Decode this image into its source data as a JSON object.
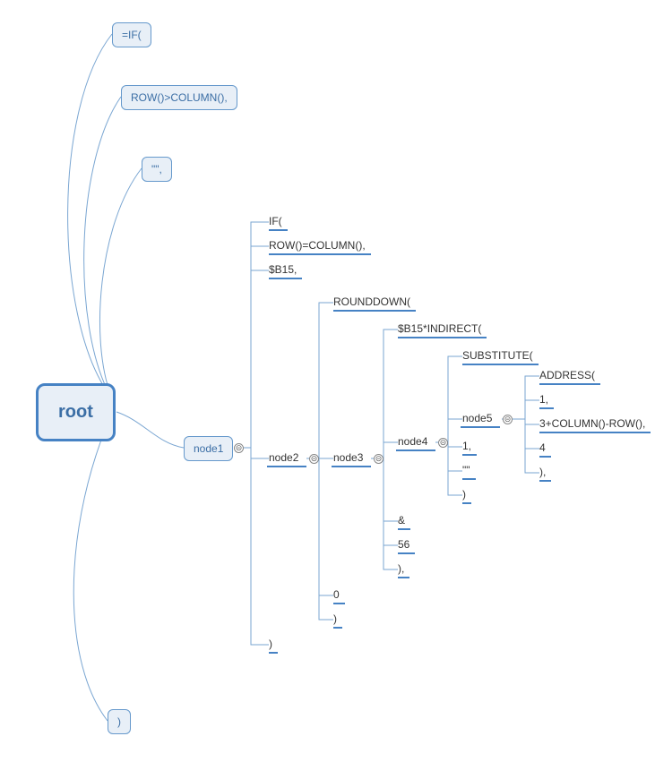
{
  "root": {
    "label": "root"
  },
  "l0": {
    "if": "=IF(",
    "cond": "ROW()>COLUMN(),",
    "empty": "\"\",",
    "close": ")"
  },
  "node1": {
    "label": "node1"
  },
  "n1": {
    "if": "IF(",
    "cond": "ROW()=COLUMN(),",
    "b15": "$B15,",
    "close": ")"
  },
  "node2": {
    "label": "node2"
  },
  "n2": {
    "rd": "ROUNDDOWN(",
    "zero": "0",
    "close": ")"
  },
  "node3": {
    "label": "node3"
  },
  "n3": {
    "ind": "$B15*INDIRECT(",
    "amp": "&",
    "fiftysix": "56",
    "close": "),"
  },
  "node4": {
    "label": "node4"
  },
  "n4": {
    "sub": "SUBSTITUTE(",
    "one": "1,",
    "empty": "\"\"",
    "close": ")"
  },
  "node5": {
    "label": "node5"
  },
  "n5": {
    "addr": "ADDRESS(",
    "one": "1,",
    "expr": "3+COLUMN()-ROW(),",
    "four": "4",
    "close": "),"
  },
  "toggle": "⊝"
}
